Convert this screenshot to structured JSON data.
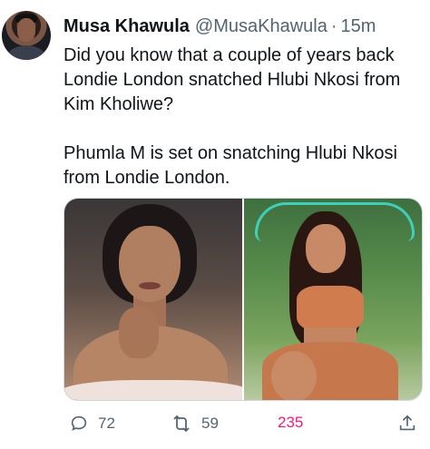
{
  "tweet": {
    "author_name": "Musa Khawula",
    "handle": "@MusaKhawula",
    "separator": "·",
    "time": "15m",
    "text_paragraphs": [
      "Did you know that a couple of years back Londie London snatched Hlubi Nkosi from Kim Kholiwe?",
      "Phumla M is set on snatching Hlubi Nkosi from Londie London."
    ]
  },
  "actions": {
    "replies": "72",
    "retweets": "59",
    "likes": "235"
  },
  "colors": {
    "text": "#0f1419",
    "muted": "#536471",
    "like_active": "#f91880"
  },
  "icons": {
    "reply": "reply-icon",
    "retweet": "retweet-icon",
    "share": "share-icon"
  }
}
